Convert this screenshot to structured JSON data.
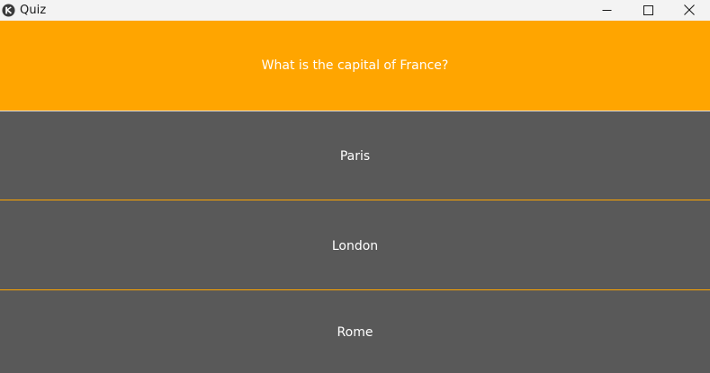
{
  "window": {
    "title": "Quiz",
    "app_icon": "kivy-logo-icon",
    "controls": [
      "minimize-icon",
      "maximize-icon",
      "close-icon"
    ]
  },
  "quiz": {
    "question": "What is the capital of France?",
    "answers": [
      {
        "label": "Paris"
      },
      {
        "label": "London"
      },
      {
        "label": "Rome"
      }
    ]
  },
  "colors": {
    "accent": "#ffa500",
    "button_bg": "#595959",
    "text": "#ffffff",
    "titlebar_bg": "#f3f3f3"
  }
}
